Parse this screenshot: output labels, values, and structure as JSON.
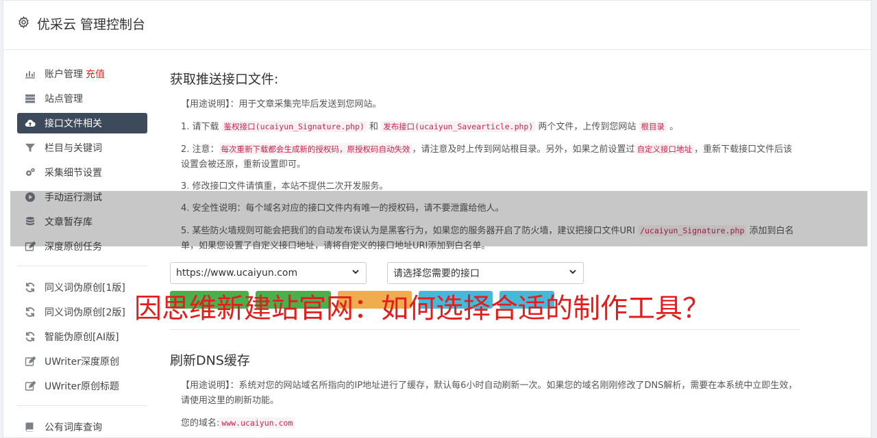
{
  "app": {
    "title": "优采云 管理控制台"
  },
  "sidebar": {
    "group1": [
      {
        "label": "账户管理",
        "badge": "充值",
        "icon": "bar-chart-icon"
      },
      {
        "label": "站点管理",
        "icon": "server-icon"
      },
      {
        "label": "接口文件相关",
        "icon": "cloud-upload-icon",
        "active": true
      },
      {
        "label": "栏目与关键词",
        "icon": "filter-icon"
      },
      {
        "label": "采集细节设置",
        "icon": "cogs-icon"
      },
      {
        "label": "手动运行测试",
        "icon": "play-circle-icon"
      },
      {
        "label": "文章暂存库",
        "icon": "database-icon"
      },
      {
        "label": "深度原创任务",
        "icon": "edit-icon"
      }
    ],
    "group2": [
      {
        "label": "同义词伪原创[1版]",
        "icon": "refresh-icon"
      },
      {
        "label": "同义词伪原创[2版]",
        "icon": "refresh-icon"
      },
      {
        "label": "智能伪原创[AI版]",
        "icon": "refresh-icon"
      },
      {
        "label": "UWriter深度原创",
        "icon": "edit-icon"
      },
      {
        "label": "UWriter原创标题",
        "icon": "edit-icon"
      }
    ],
    "group3": [
      {
        "label": "公有词库查询",
        "icon": "book-icon"
      }
    ]
  },
  "section1": {
    "title": "获取推送接口文件:",
    "usage": "【用途说明】：用于文章采集完毕后发送到您网站。",
    "step1_pre": "1. 请下载 ",
    "step1_code1": "鉴权接口(ucaiyun_Signature.php)",
    "step1_mid": " 和 ",
    "step1_code2": "发布接口(ucaiyun_Savearticle.php)",
    "step1_post": " 两个文件，上传到您网站 ",
    "step1_code3": "根目录",
    "step1_end": " 。",
    "step2_pre": "2. 注意：",
    "step2_code1": "每次重新下载都会生成新的授权码，原授权码自动失效",
    "step2_mid": "，请注意及时上传到网站根目录。另外，如果之前设置过",
    "step2_code2": "自定义接口地址",
    "step2_post": "，重新下载接口文件后该设置会被还原，重新设置即可。",
    "step3": "3. 修改接口文件请慎重，本站不提供二次开发服务。",
    "step4": "4. 安全性说明：每个域名对应的接口文件内有唯一的授权码，请不要泄露给他人。",
    "step5_pre": "5. 某些防火墙规则可能会把我们的自动发布误认为是黑客行为，如果您的服务器开启了防火墙，建议把接口文件URI ",
    "step5_code": "/ucaiyun_Signature.php",
    "step5_post": " 添加到白名单，如果您设置了自定义接口地址，请将自定义的接口地址URI添加到白名单。",
    "site_select": "https://www.ucaiyun.com",
    "api_select": "请选择您需要的接口"
  },
  "section2": {
    "title": "刷新DNS缓存",
    "usage": "【用途说明】：系统对您的网站域名所指向的IP地址进行了缓存，默认每6小时自动刷新一次。如果您的域名刚刚修改了DNS解析，需要在本系统中立即生效，请使用这里的刷新功能。",
    "domain_label": "您的域名:",
    "domain_value": "www.ucaiyun.com"
  },
  "overlay": {
    "headline": "因思维新建站官网：如何选择合适的制作工具？"
  }
}
